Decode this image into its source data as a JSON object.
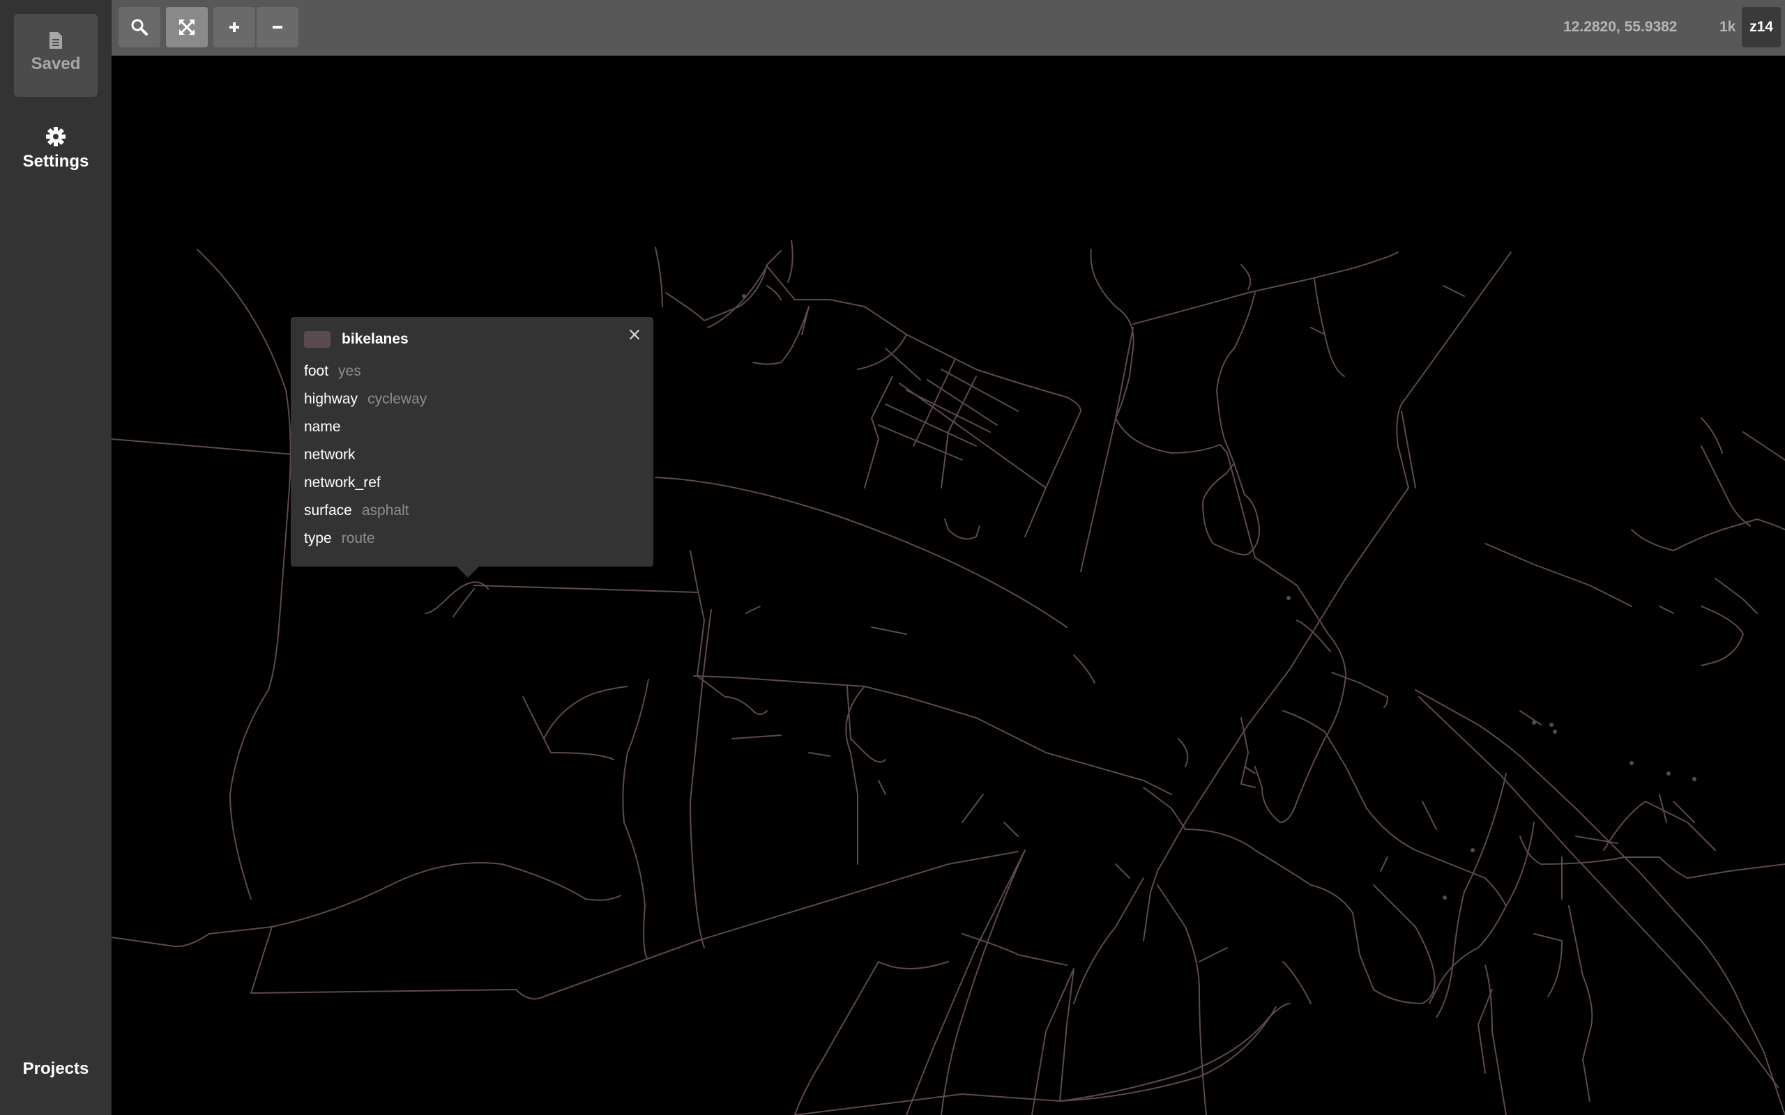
{
  "sidebar": {
    "saved_label": "Saved",
    "settings_label": "Settings",
    "projects_label": "Projects"
  },
  "toolbar": {
    "buttons": [
      {
        "icon": "search-icon"
      },
      {
        "icon": "expand-icon"
      },
      {
        "icon": "plus-icon"
      },
      {
        "icon": "minus-icon"
      }
    ],
    "coordinates": "12.2820, 55.9382",
    "scale": "1k",
    "zoom": "z14"
  },
  "popup": {
    "layer": "bikelanes",
    "swatch_color": "#5c4a52",
    "properties": [
      {
        "key": "foot",
        "value": "yes"
      },
      {
        "key": "highway",
        "value": "cycleway"
      },
      {
        "key": "name",
        "value": ""
      },
      {
        "key": "network",
        "value": ""
      },
      {
        "key": "network_ref",
        "value": ""
      },
      {
        "key": "surface",
        "value": "asphalt"
      },
      {
        "key": "type",
        "value": "route"
      }
    ]
  },
  "map": {
    "background": "#000000",
    "line_color": "#5e4852"
  }
}
